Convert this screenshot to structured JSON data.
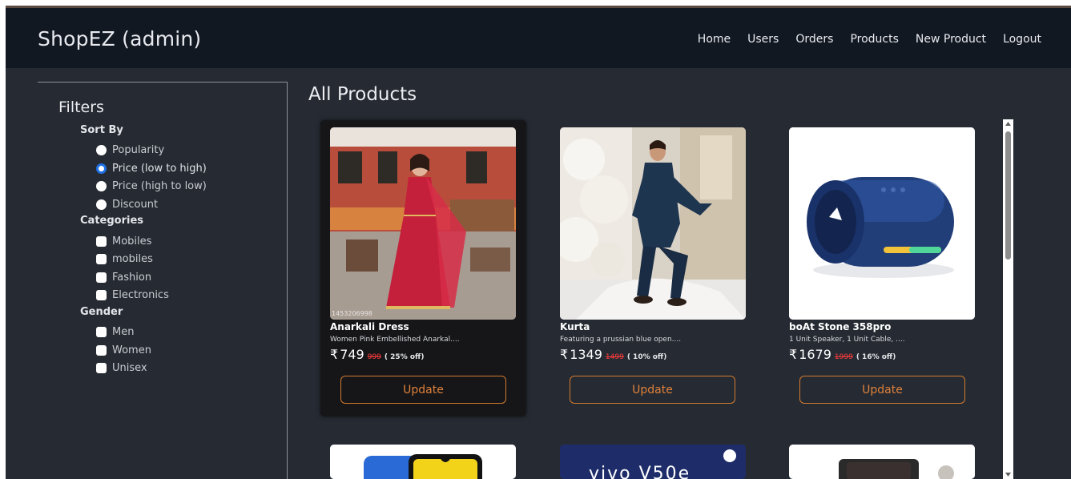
{
  "app": {
    "brand": "ShopEZ (admin)"
  },
  "nav": [
    "Home",
    "Users",
    "Orders",
    "Products",
    "New Product",
    "Logout"
  ],
  "filters": {
    "title": "Filters",
    "sort": {
      "title": "Sort By",
      "options": [
        "Popularity",
        "Price (low to high)",
        "Price (high to low)",
        "Discount"
      ],
      "selected": "Price (low to high)"
    },
    "categories": {
      "title": "Categories",
      "options": [
        "Mobiles",
        "mobiles",
        "Fashion",
        "Electronics"
      ]
    },
    "gender": {
      "title": "Gender",
      "options": [
        "Men",
        "Women",
        "Unisex"
      ]
    }
  },
  "main": {
    "title": "All Products"
  },
  "products": [
    {
      "name": "Anarkali Dress",
      "desc": "Women Pink Embellished Anarkal....",
      "currency": "₹",
      "price": "749",
      "old_price": "999",
      "discount": "( 25% off)",
      "button": "Update",
      "watermark": "1453206998"
    },
    {
      "name": "Kurta",
      "desc": "Featuring a prussian blue open....",
      "currency": "₹",
      "price": "1349",
      "old_price": "1499",
      "discount": "( 10% off)",
      "button": "Update"
    },
    {
      "name": "boAt Stone 358pro",
      "desc": "1 Unit Speaker, 1 Unit Cable, ....",
      "currency": "₹",
      "price": "1679",
      "old_price": "1999",
      "discount": "( 16% off)",
      "button": "Update"
    }
  ],
  "partial_products": [
    {
      "image_text": ""
    },
    {
      "image_text": "vivo V50e"
    },
    {
      "image_text": ""
    }
  ],
  "colors": {
    "navbar": "#121822",
    "page": "#262b33",
    "accent": "#d27a2e",
    "radio_selected": "#1f6fe5",
    "strike_price": "#ff3b3b"
  }
}
